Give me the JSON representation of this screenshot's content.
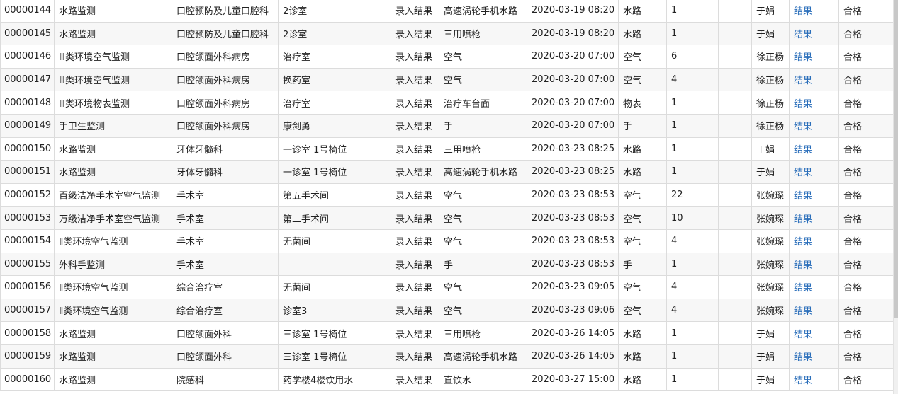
{
  "records": [
    {
      "id": "00000144",
      "item": "水路监测",
      "dept": "口腔预防及儿童口腔科",
      "location": "2诊室",
      "action": "录入结果",
      "object": "高速涡轮手机水路",
      "time": "2020-03-19 08:20",
      "type": "水路",
      "count": "1",
      "extra": "",
      "person": "于娟",
      "result": "结果",
      "status": "合格"
    },
    {
      "id": "00000145",
      "item": "水路监测",
      "dept": "口腔预防及儿童口腔科",
      "location": "2诊室",
      "action": "录入结果",
      "object": "三用喷枪",
      "time": "2020-03-19 08:20",
      "type": "水路",
      "count": "1",
      "extra": "",
      "person": "于娟",
      "result": "结果",
      "status": "合格"
    },
    {
      "id": "00000146",
      "item": "Ⅲ类环境空气监测",
      "dept": "口腔颌面外科病房",
      "location": "治疗室",
      "action": "录入结果",
      "object": "空气",
      "time": "2020-03-20 07:00",
      "type": "空气",
      "count": "6",
      "extra": "",
      "person": "徐正杨",
      "result": "结果",
      "status": "合格"
    },
    {
      "id": "00000147",
      "item": "Ⅲ类环境空气监测",
      "dept": "口腔颌面外科病房",
      "location": "换药室",
      "action": "录入结果",
      "object": "空气",
      "time": "2020-03-20 07:00",
      "type": "空气",
      "count": "4",
      "extra": "",
      "person": "徐正杨",
      "result": "结果",
      "status": "合格"
    },
    {
      "id": "00000148",
      "item": "Ⅲ类环境物表监测",
      "dept": "口腔颌面外科病房",
      "location": "治疗室",
      "action": "录入结果",
      "object": "治疗车台面",
      "time": "2020-03-20 07:00",
      "type": "物表",
      "count": "1",
      "extra": "",
      "person": "徐正杨",
      "result": "结果",
      "status": "合格"
    },
    {
      "id": "00000149",
      "item": "手卫生监测",
      "dept": "口腔颌面外科病房",
      "location": "康剑勇",
      "action": "录入结果",
      "object": "手",
      "time": "2020-03-20 07:00",
      "type": "手",
      "count": "1",
      "extra": "",
      "person": "徐正杨",
      "result": "结果",
      "status": "合格"
    },
    {
      "id": "00000150",
      "item": "水路监测",
      "dept": "牙体牙髓科",
      "location": "一诊室 1号椅位",
      "action": "录入结果",
      "object": "三用喷枪",
      "time": "2020-03-23 08:25",
      "type": "水路",
      "count": "1",
      "extra": "",
      "person": "于娟",
      "result": "结果",
      "status": "合格"
    },
    {
      "id": "00000151",
      "item": "水路监测",
      "dept": "牙体牙髓科",
      "location": "一诊室 1号椅位",
      "action": "录入结果",
      "object": "高速涡轮手机水路",
      "time": "2020-03-23 08:25",
      "type": "水路",
      "count": "1",
      "extra": "",
      "person": "于娟",
      "result": "结果",
      "status": "合格"
    },
    {
      "id": "00000152",
      "item": "百级洁净手术室空气监测",
      "dept": "手术室",
      "location": "第五手术间",
      "action": "录入结果",
      "object": "空气",
      "time": "2020-03-23 08:53",
      "type": "空气",
      "count": "22",
      "extra": "",
      "person": "张婉琛",
      "result": "结果",
      "status": "合格"
    },
    {
      "id": "00000153",
      "item": "万级洁净手术室空气监测",
      "dept": "手术室",
      "location": "第二手术间",
      "action": "录入结果",
      "object": "空气",
      "time": "2020-03-23 08:53",
      "type": "空气",
      "count": "10",
      "extra": "",
      "person": "张婉琛",
      "result": "结果",
      "status": "合格"
    },
    {
      "id": "00000154",
      "item": "Ⅱ类环境空气监测",
      "dept": "手术室",
      "location": "无菌间",
      "action": "录入结果",
      "object": "空气",
      "time": "2020-03-23 08:53",
      "type": "空气",
      "count": "4",
      "extra": "",
      "person": "张婉琛",
      "result": "结果",
      "status": "合格"
    },
    {
      "id": "00000155",
      "item": "外科手监测",
      "dept": "手术室",
      "location": "",
      "action": "录入结果",
      "object": "手",
      "time": "2020-03-23 08:53",
      "type": "手",
      "count": "1",
      "extra": "",
      "person": "张婉琛",
      "result": "结果",
      "status": "合格"
    },
    {
      "id": "00000156",
      "item": "Ⅱ类环境空气监测",
      "dept": "综合治疗室",
      "location": "无菌间",
      "action": "录入结果",
      "object": "空气",
      "time": "2020-03-23 09:05",
      "type": "空气",
      "count": "4",
      "extra": "",
      "person": "张婉琛",
      "result": "结果",
      "status": "合格"
    },
    {
      "id": "00000157",
      "item": "Ⅱ类环境空气监测",
      "dept": "综合治疗室",
      "location": "诊室3",
      "action": "录入结果",
      "object": "空气",
      "time": "2020-03-23 09:06",
      "type": "空气",
      "count": "4",
      "extra": "",
      "person": "张婉琛",
      "result": "结果",
      "status": "合格"
    },
    {
      "id": "00000158",
      "item": "水路监测",
      "dept": "口腔颌面外科",
      "location": "三诊室 1号椅位",
      "action": "录入结果",
      "object": "三用喷枪",
      "time": "2020-03-26 14:05",
      "type": "水路",
      "count": "1",
      "extra": "",
      "person": "于娟",
      "result": "结果",
      "status": "合格"
    },
    {
      "id": "00000159",
      "item": "水路监测",
      "dept": "口腔颌面外科",
      "location": "三诊室 1号椅位",
      "action": "录入结果",
      "object": "高速涡轮手机水路",
      "time": "2020-03-26 14:05",
      "type": "水路",
      "count": "1",
      "extra": "",
      "person": "于娟",
      "result": "结果",
      "status": "合格"
    },
    {
      "id": "00000160",
      "item": "水路监测",
      "dept": "院感科",
      "location": "药学楼4楼饮用水",
      "action": "录入结果",
      "object": "直饮水",
      "time": "2020-03-27 15:00",
      "type": "水路",
      "count": "1",
      "extra": "",
      "person": "于娟",
      "result": "结果",
      "status": "合格"
    }
  ]
}
